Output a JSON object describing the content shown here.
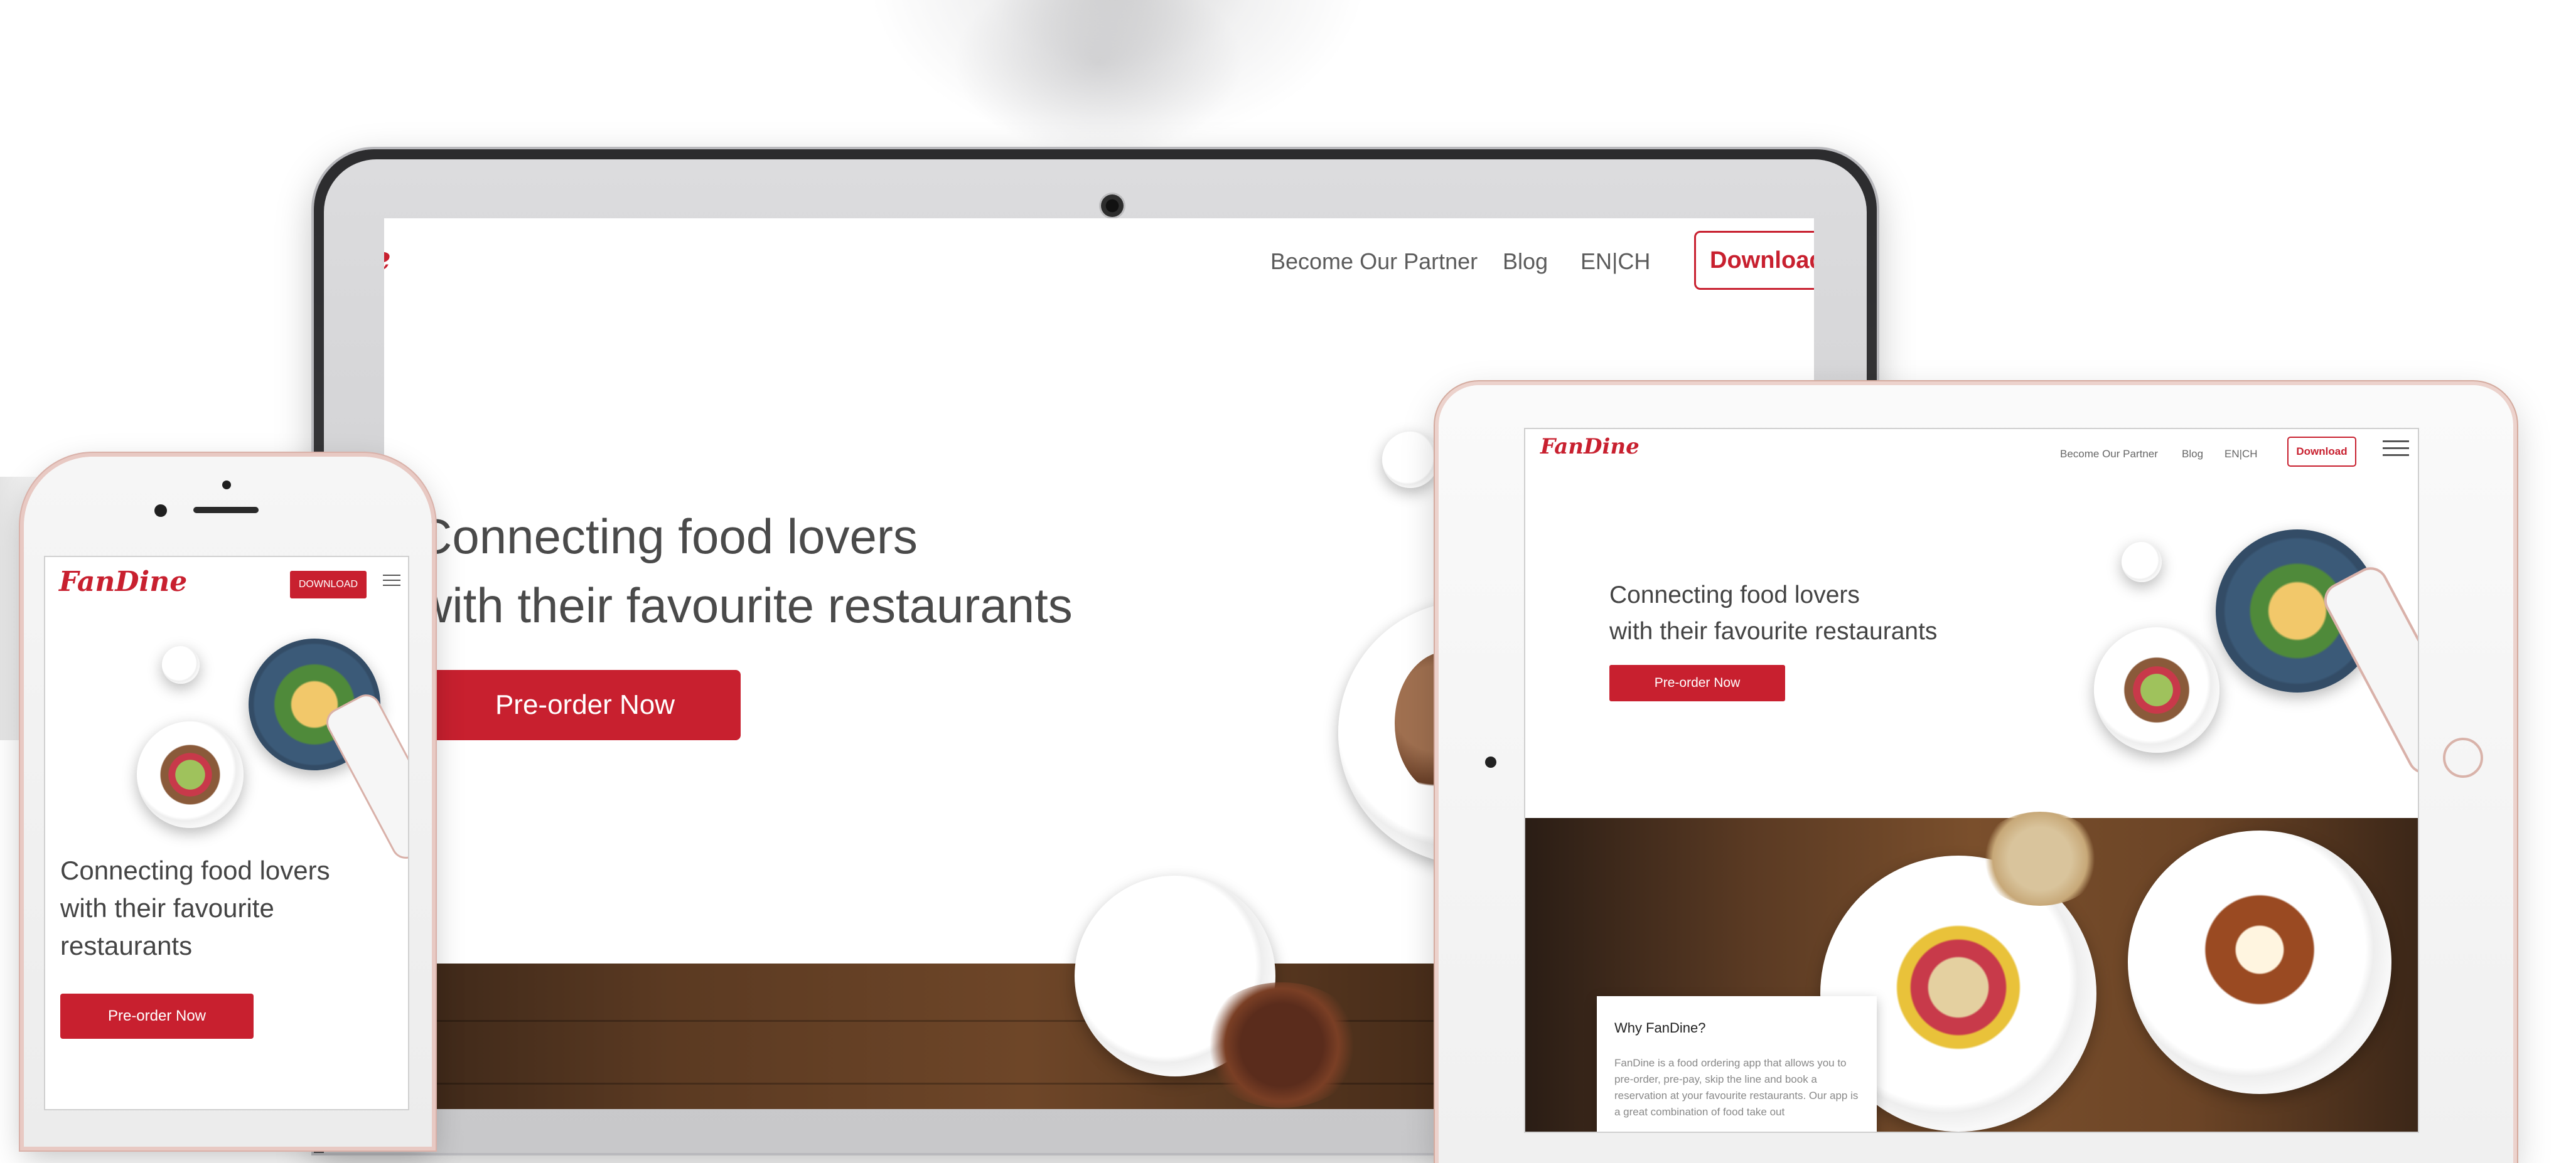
{
  "brand": {
    "logo_text": "FanDine",
    "laptop_logo_text": "ne",
    "accent_color": "#c8202f"
  },
  "laptop": {
    "nav": {
      "partner": "Become Our Partner",
      "blog": "Blog",
      "lang": "EN|CH",
      "download": "Download"
    },
    "hero": {
      "line1": "Connecting food lovers",
      "line2": "with their favourite restaurants",
      "cta": "Pre-order Now"
    }
  },
  "phone": {
    "download": "DOWNLOAD",
    "hero": {
      "line1": "Connecting food lovers",
      "line2": "with their favourite",
      "line3": "restaurants",
      "cta": "Pre-order Now"
    }
  },
  "tablet": {
    "nav": {
      "partner": "Become Our Partner",
      "blog": "Blog",
      "lang": "EN|CH",
      "download": "Download"
    },
    "hero": {
      "line1": "Connecting food lovers",
      "line2": "with their favourite restaurants",
      "cta": "Pre-order Now"
    },
    "card": {
      "title": "Why FanDine?",
      "body": "FanDine is a food ordering app that allows you to pre-order, pre-pay, skip the line and book a reservation at your favourite restaurants. Our app is a great combination of food take out"
    }
  },
  "icons": [
    "hamburger-menu-icon",
    "camera-icon",
    "home-button-icon"
  ]
}
